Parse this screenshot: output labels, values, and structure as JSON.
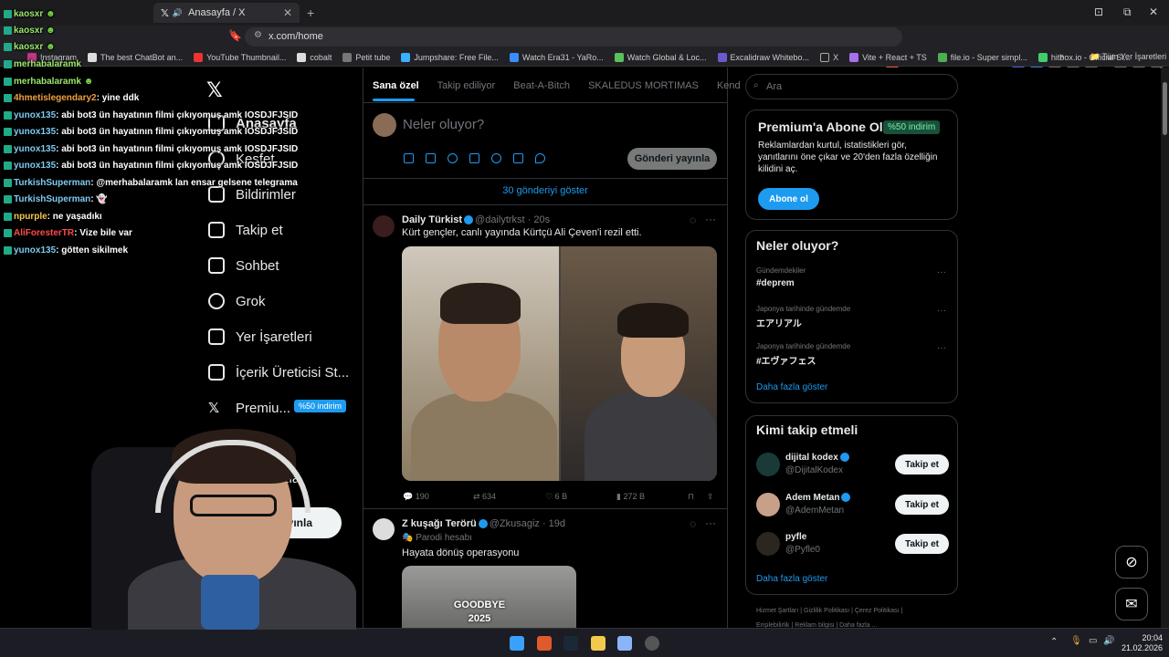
{
  "browser": {
    "tab_title": "Anasayfa / X",
    "url": "x.com/home",
    "bookmarks": [
      "Instagram",
      "The best ChatBot an...",
      "YouTube Thumbnail...",
      "cobalt",
      "Petit tube",
      "Jumpshare: Free File...",
      "Watch Era31 - YaRo...",
      "Watch Global & Loc...",
      "Excalidraw Whitebo...",
      "X",
      "Vite + React + TS",
      "file.io - Super simpl...",
      "hitbox.io - Official Si..."
    ],
    "all_bookmarks": "Tüm Yer İşaretleri"
  },
  "chat": [
    {
      "user": "kaosxr",
      "color": "#9be86b",
      "msg": ""
    },
    {
      "user": "kaosxr",
      "color": "#9be86b",
      "msg": ""
    },
    {
      "user": "kaosxr",
      "color": "#9be86b",
      "msg": ""
    },
    {
      "user": "merhabalaramk",
      "color": "#9be86b",
      "msg": ""
    },
    {
      "user": "merhabalaramk",
      "color": "#9be86b",
      "msg": ""
    },
    {
      "user": "4hmetislegendary2",
      "color": "#f0a040",
      "msg": ": yine ddk"
    },
    {
      "user": "yunox135",
      "color": "#7ecbf2",
      "msg": ": abi bot3 ün hayatının filmi çıkıyomuş amk IOSDJFJSID"
    },
    {
      "user": "yunox135",
      "color": "#7ecbf2",
      "msg": ": abi bot3 ün hayatının filmi çıkıyomuş amk IOSDJFJSID"
    },
    {
      "user": "yunox135",
      "color": "#7ecbf2",
      "msg": ": abi bot3 ün hayatının filmi çıkıyomuş amk IOSDJFJSID"
    },
    {
      "user": "yunox135",
      "color": "#7ecbf2",
      "msg": ": abi bot3 ün hayatının filmi çıkıyomuş amk IOSDJFJSID"
    },
    {
      "user": "TurkishSuperman",
      "color": "#7ecbf2",
      "msg": ": @merhabalaramk lan ensar gelsene telegrama"
    },
    {
      "user": "TurkishSuperman",
      "color": "#7ecbf2",
      "msg": ":"
    },
    {
      "user": "npurple",
      "color": "#f2c94c",
      "msg": ": ne yaşadıkı"
    },
    {
      "user": "AliForesterTR",
      "color": "#ff4a4a",
      "msg": ": Vize bile var"
    },
    {
      "user": "yunox135",
      "color": "#7ecbf2",
      "msg": ": götten sikilmek"
    }
  ],
  "nav": {
    "items": [
      "Anasayfa",
      "Keşfet",
      "Bildirimler",
      "Takip et",
      "Sohbet",
      "Grok",
      "Yer İşaretleri",
      "İçerik Üreticisi St...",
      "Premiu...",
      "fil",
      "a fazla"
    ],
    "premium_badge": "%50 indirim",
    "post_button": "ri yayınla"
  },
  "timeline": {
    "tabs": [
      "Sana özel",
      "Takip ediliyor",
      "Beat-A-Bitch",
      "SKALEDUS MORTIMAS",
      "Kend"
    ],
    "compose_placeholder": "Neler oluyor?",
    "publish_button": "Gönderi yayınla",
    "show_more": "30 gönderiyi göster",
    "posts": [
      {
        "name": "Daily Türkist",
        "handle": "@dailytrkst · 20s",
        "text": "Kürt gençler, canlı yayında Kürtçü Ali Çeven'i rezil etti.",
        "replies": "190",
        "reposts": "634",
        "likes": "6 B",
        "views": "272 B"
      },
      {
        "name": "Z kuşağı Terörü",
        "handle": "@Zkusagiz · 19d",
        "sub": "Parodi hesabı",
        "text": "Hayata dönüş operasyonu",
        "media_text": "GOODBYE 2025"
      }
    ]
  },
  "right": {
    "search_placeholder": "Ara",
    "premium": {
      "title": "Premium'a Abone Ol",
      "pill": "%50 indirim",
      "desc": "Reklamlardan kurtul, istatistikleri gör, yanıtlarını öne çıkar ve 20'den fazla özelliğin kilidini aç.",
      "button": "Abone ol"
    },
    "trends": {
      "title": "Neler oluyor?",
      "items": [
        {
          "ctx": "Gündemdekiler",
          "name": "#deprem"
        },
        {
          "ctx": "Japonya tarihinde gündemde",
          "name": "エアリアル"
        },
        {
          "ctx": "Japonya tarihinde gündemde",
          "name": "#エヴァフェス"
        }
      ],
      "more": "Daha fazla göster"
    },
    "who": {
      "title": "Kimi takip etmeli",
      "items": [
        {
          "name": "dijital kodex",
          "handle": "@DijitalKodex",
          "button": "Takip et"
        },
        {
          "name": "Adem Metan",
          "handle": "@AdemMetan",
          "button": "Takip et"
        },
        {
          "name": "pyfle",
          "handle": "@Pyfle0",
          "button": "Takip et"
        }
      ],
      "more": "Daha fazla göster"
    },
    "footer1": "Hizmet Şartları  |  Gizlilik Politikası  |  Çerez Politikası  |",
    "footer2": "Erişilebilirlik  |  Reklam bilgisi  |  Daha fazla ..."
  },
  "taskbar": {
    "time": "20:04",
    "date": "21.02.2026"
  },
  "colors": {
    "accent": "#1d9bf0",
    "bg": "#000000",
    "border": "#2f3336"
  }
}
